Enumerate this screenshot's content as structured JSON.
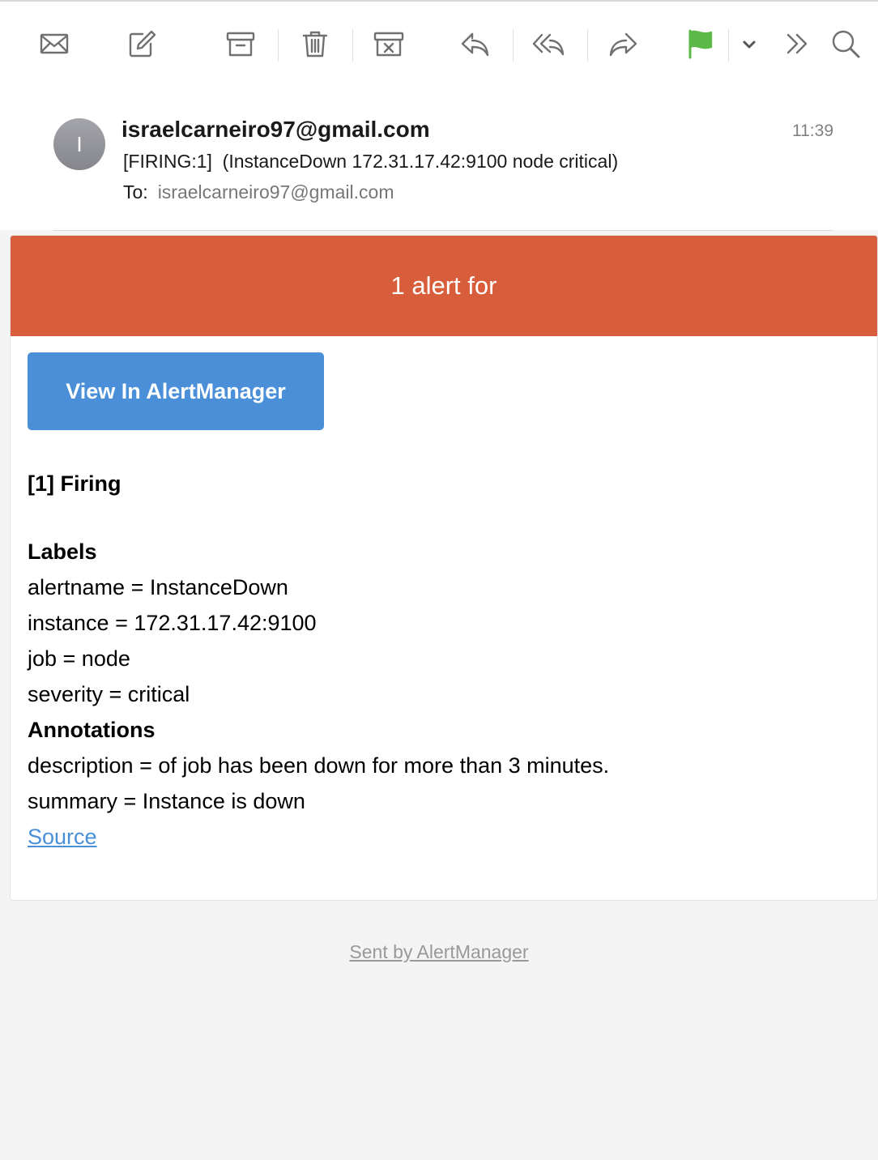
{
  "toolbar": {
    "icons": [
      "envelope-icon",
      "compose-icon",
      "archive-icon",
      "trash-icon",
      "junk-icon",
      "reply-icon",
      "reply-all-icon",
      "forward-icon",
      "flag-icon",
      "chevron-down-icon",
      "more-icon",
      "search-icon"
    ],
    "flag_color": "#5cb947"
  },
  "header": {
    "avatar_initial": "I",
    "sender": "israelcarneiro97@gmail.com",
    "time": "11:39",
    "subject": "[FIRING:1]  (InstanceDown 172.31.17.42:9100 node critical)",
    "to_label": "To:",
    "to_address": "israelcarneiro97@gmail.com"
  },
  "alert": {
    "banner_title": "1 alert for",
    "banner_color": "#d85d3b",
    "view_button": "View In AlertManager",
    "button_color": "#4a8fd8",
    "firing_heading": "[1] Firing",
    "labels_heading": "Labels",
    "labels": [
      "alertname = InstanceDown",
      "instance = 172.31.17.42:9100",
      "job = node",
      "severity = critical"
    ],
    "annotations_heading": "Annotations",
    "annotations": [
      "description = of job has been down for more than 3 minutes.",
      "summary = Instance is down"
    ],
    "source_link": "Source"
  },
  "footer": {
    "sent_by": "Sent by AlertManager"
  }
}
